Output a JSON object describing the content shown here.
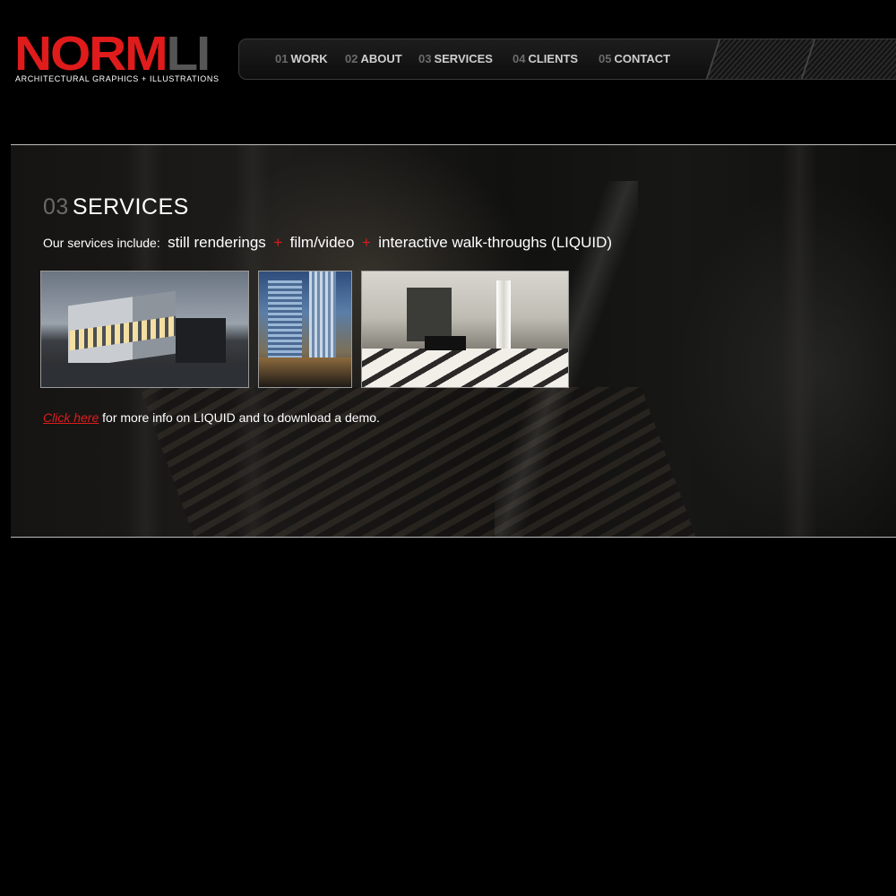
{
  "logo": {
    "brand_main": "NORM",
    "brand_accent": "LI",
    "tagline": "ARCHITECTURAL GRAPHICS + ILLUSTRATIONS"
  },
  "nav": {
    "items": [
      {
        "num": "01",
        "label": "WORK"
      },
      {
        "num": "02",
        "label": "ABOUT"
      },
      {
        "num": "03",
        "label": "SERVICES"
      },
      {
        "num": "04",
        "label": "CLIENTS"
      },
      {
        "num": "05",
        "label": "CONTACT"
      }
    ]
  },
  "main": {
    "section_num": "03",
    "section_title": "SERVICES",
    "services_intro": "Our services include:",
    "services": [
      "still renderings",
      "film/video",
      "interactive walk-throughs (LIQUID)"
    ],
    "plus_symbol": "+",
    "link_text": "Click here",
    "more_text": " for more info on LIQUID and to download a demo."
  },
  "colors": {
    "accent": "#e01b1b",
    "background": "#000000",
    "muted_number": "#6a6a6a"
  }
}
